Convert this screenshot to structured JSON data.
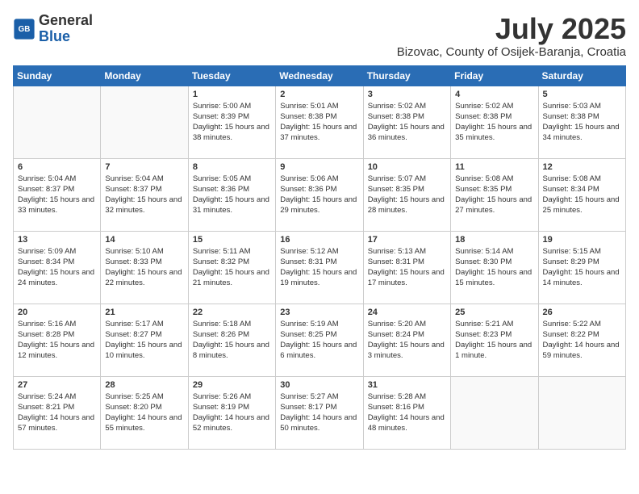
{
  "logo": {
    "line1": "General",
    "line2": "Blue"
  },
  "title": "July 2025",
  "location": "Bizovac, County of Osijek-Baranja, Croatia",
  "weekdays": [
    "Sunday",
    "Monday",
    "Tuesday",
    "Wednesday",
    "Thursday",
    "Friday",
    "Saturday"
  ],
  "weeks": [
    [
      {
        "day": "",
        "sunrise": "",
        "sunset": "",
        "daylight": ""
      },
      {
        "day": "",
        "sunrise": "",
        "sunset": "",
        "daylight": ""
      },
      {
        "day": "1",
        "sunrise": "Sunrise: 5:00 AM",
        "sunset": "Sunset: 8:39 PM",
        "daylight": "Daylight: 15 hours and 38 minutes."
      },
      {
        "day": "2",
        "sunrise": "Sunrise: 5:01 AM",
        "sunset": "Sunset: 8:38 PM",
        "daylight": "Daylight: 15 hours and 37 minutes."
      },
      {
        "day": "3",
        "sunrise": "Sunrise: 5:02 AM",
        "sunset": "Sunset: 8:38 PM",
        "daylight": "Daylight: 15 hours and 36 minutes."
      },
      {
        "day": "4",
        "sunrise": "Sunrise: 5:02 AM",
        "sunset": "Sunset: 8:38 PM",
        "daylight": "Daylight: 15 hours and 35 minutes."
      },
      {
        "day": "5",
        "sunrise": "Sunrise: 5:03 AM",
        "sunset": "Sunset: 8:38 PM",
        "daylight": "Daylight: 15 hours and 34 minutes."
      }
    ],
    [
      {
        "day": "6",
        "sunrise": "Sunrise: 5:04 AM",
        "sunset": "Sunset: 8:37 PM",
        "daylight": "Daylight: 15 hours and 33 minutes."
      },
      {
        "day": "7",
        "sunrise": "Sunrise: 5:04 AM",
        "sunset": "Sunset: 8:37 PM",
        "daylight": "Daylight: 15 hours and 32 minutes."
      },
      {
        "day": "8",
        "sunrise": "Sunrise: 5:05 AM",
        "sunset": "Sunset: 8:36 PM",
        "daylight": "Daylight: 15 hours and 31 minutes."
      },
      {
        "day": "9",
        "sunrise": "Sunrise: 5:06 AM",
        "sunset": "Sunset: 8:36 PM",
        "daylight": "Daylight: 15 hours and 29 minutes."
      },
      {
        "day": "10",
        "sunrise": "Sunrise: 5:07 AM",
        "sunset": "Sunset: 8:35 PM",
        "daylight": "Daylight: 15 hours and 28 minutes."
      },
      {
        "day": "11",
        "sunrise": "Sunrise: 5:08 AM",
        "sunset": "Sunset: 8:35 PM",
        "daylight": "Daylight: 15 hours and 27 minutes."
      },
      {
        "day": "12",
        "sunrise": "Sunrise: 5:08 AM",
        "sunset": "Sunset: 8:34 PM",
        "daylight": "Daylight: 15 hours and 25 minutes."
      }
    ],
    [
      {
        "day": "13",
        "sunrise": "Sunrise: 5:09 AM",
        "sunset": "Sunset: 8:34 PM",
        "daylight": "Daylight: 15 hours and 24 minutes."
      },
      {
        "day": "14",
        "sunrise": "Sunrise: 5:10 AM",
        "sunset": "Sunset: 8:33 PM",
        "daylight": "Daylight: 15 hours and 22 minutes."
      },
      {
        "day": "15",
        "sunrise": "Sunrise: 5:11 AM",
        "sunset": "Sunset: 8:32 PM",
        "daylight": "Daylight: 15 hours and 21 minutes."
      },
      {
        "day": "16",
        "sunrise": "Sunrise: 5:12 AM",
        "sunset": "Sunset: 8:31 PM",
        "daylight": "Daylight: 15 hours and 19 minutes."
      },
      {
        "day": "17",
        "sunrise": "Sunrise: 5:13 AM",
        "sunset": "Sunset: 8:31 PM",
        "daylight": "Daylight: 15 hours and 17 minutes."
      },
      {
        "day": "18",
        "sunrise": "Sunrise: 5:14 AM",
        "sunset": "Sunset: 8:30 PM",
        "daylight": "Daylight: 15 hours and 15 minutes."
      },
      {
        "day": "19",
        "sunrise": "Sunrise: 5:15 AM",
        "sunset": "Sunset: 8:29 PM",
        "daylight": "Daylight: 15 hours and 14 minutes."
      }
    ],
    [
      {
        "day": "20",
        "sunrise": "Sunrise: 5:16 AM",
        "sunset": "Sunset: 8:28 PM",
        "daylight": "Daylight: 15 hours and 12 minutes."
      },
      {
        "day": "21",
        "sunrise": "Sunrise: 5:17 AM",
        "sunset": "Sunset: 8:27 PM",
        "daylight": "Daylight: 15 hours and 10 minutes."
      },
      {
        "day": "22",
        "sunrise": "Sunrise: 5:18 AM",
        "sunset": "Sunset: 8:26 PM",
        "daylight": "Daylight: 15 hours and 8 minutes."
      },
      {
        "day": "23",
        "sunrise": "Sunrise: 5:19 AM",
        "sunset": "Sunset: 8:25 PM",
        "daylight": "Daylight: 15 hours and 6 minutes."
      },
      {
        "day": "24",
        "sunrise": "Sunrise: 5:20 AM",
        "sunset": "Sunset: 8:24 PM",
        "daylight": "Daylight: 15 hours and 3 minutes."
      },
      {
        "day": "25",
        "sunrise": "Sunrise: 5:21 AM",
        "sunset": "Sunset: 8:23 PM",
        "daylight": "Daylight: 15 hours and 1 minute."
      },
      {
        "day": "26",
        "sunrise": "Sunrise: 5:22 AM",
        "sunset": "Sunset: 8:22 PM",
        "daylight": "Daylight: 14 hours and 59 minutes."
      }
    ],
    [
      {
        "day": "27",
        "sunrise": "Sunrise: 5:24 AM",
        "sunset": "Sunset: 8:21 PM",
        "daylight": "Daylight: 14 hours and 57 minutes."
      },
      {
        "day": "28",
        "sunrise": "Sunrise: 5:25 AM",
        "sunset": "Sunset: 8:20 PM",
        "daylight": "Daylight: 14 hours and 55 minutes."
      },
      {
        "day": "29",
        "sunrise": "Sunrise: 5:26 AM",
        "sunset": "Sunset: 8:19 PM",
        "daylight": "Daylight: 14 hours and 52 minutes."
      },
      {
        "day": "30",
        "sunrise": "Sunrise: 5:27 AM",
        "sunset": "Sunset: 8:17 PM",
        "daylight": "Daylight: 14 hours and 50 minutes."
      },
      {
        "day": "31",
        "sunrise": "Sunrise: 5:28 AM",
        "sunset": "Sunset: 8:16 PM",
        "daylight": "Daylight: 14 hours and 48 minutes."
      },
      {
        "day": "",
        "sunrise": "",
        "sunset": "",
        "daylight": ""
      },
      {
        "day": "",
        "sunrise": "",
        "sunset": "",
        "daylight": ""
      }
    ]
  ]
}
